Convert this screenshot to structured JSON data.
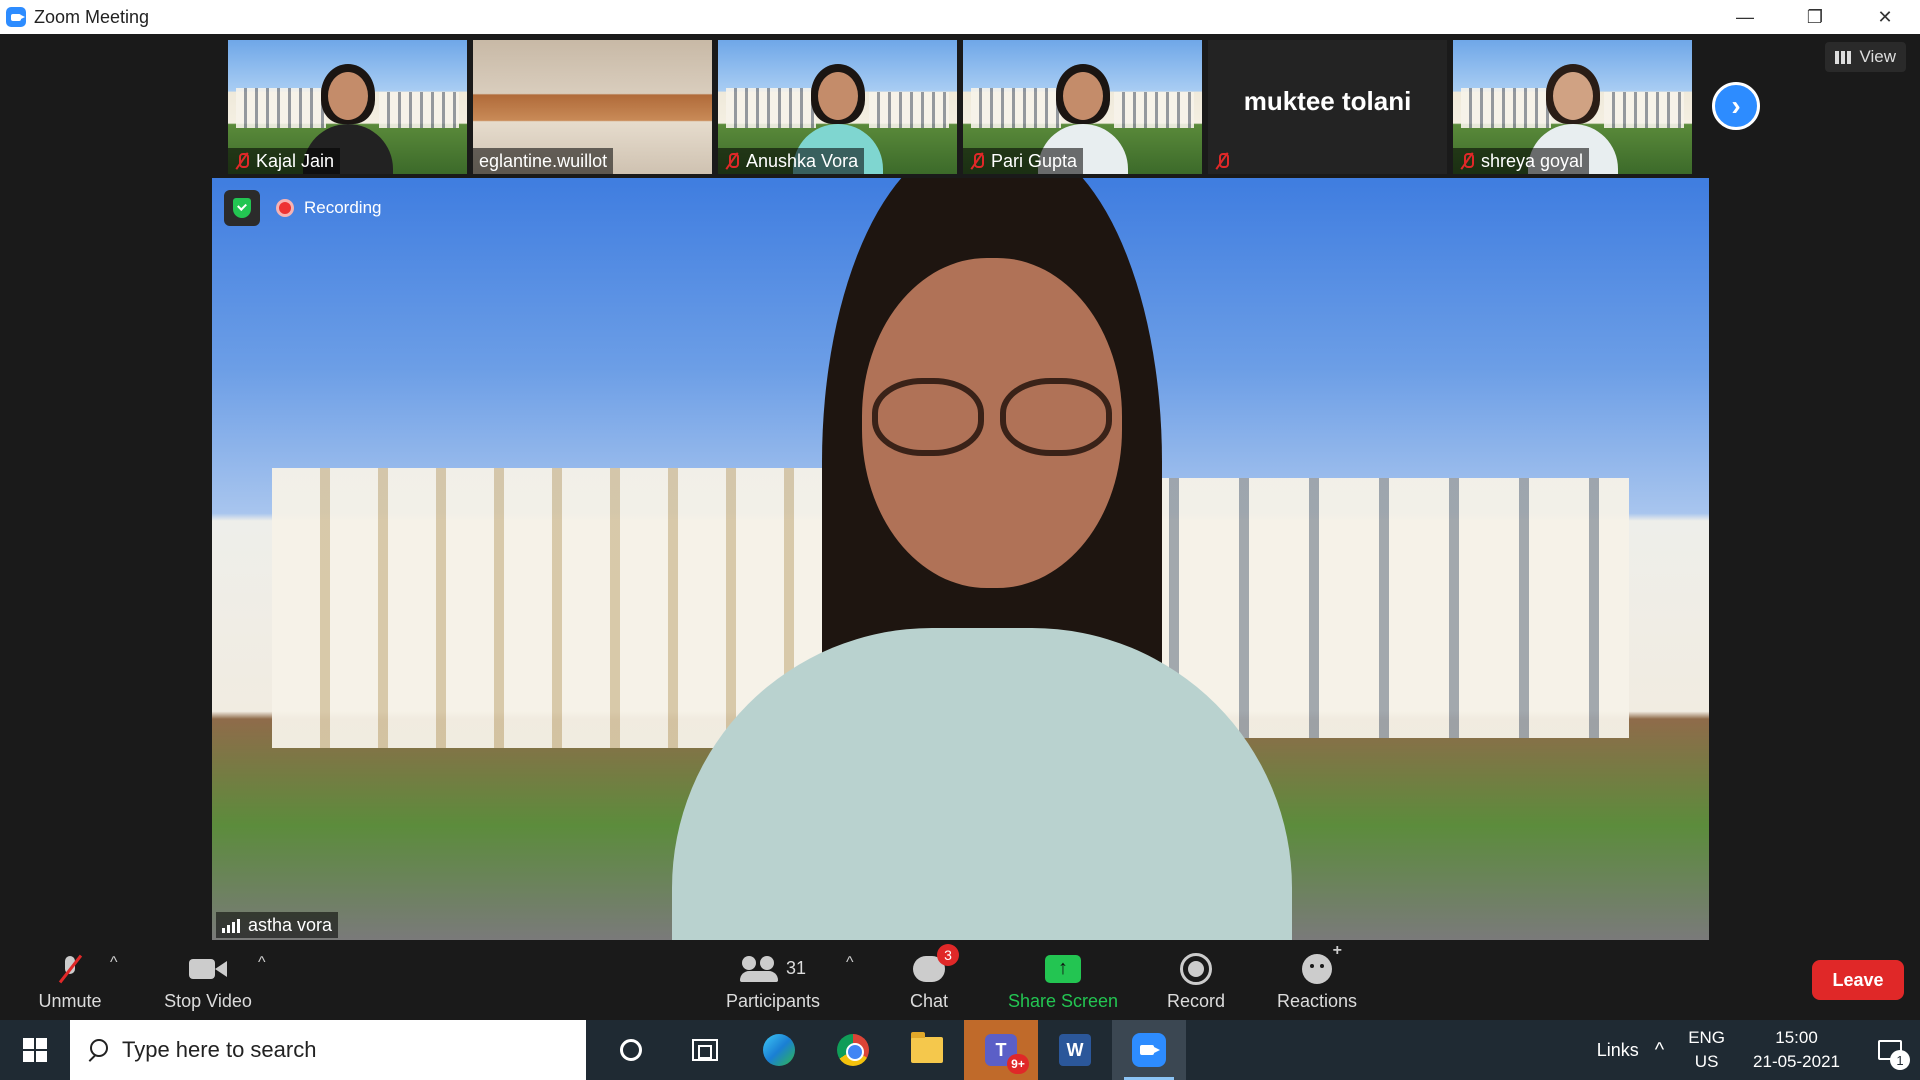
{
  "window": {
    "title": "Zoom Meeting",
    "minimize": "—",
    "restore": "❐",
    "close": "✕"
  },
  "gallery": {
    "tiles": [
      {
        "name": "Kajal Jain",
        "muted": true,
        "background": "campus"
      },
      {
        "name": "eglantine.wuillot",
        "muted": false,
        "background": "classroom"
      },
      {
        "name": "Anushka Vora",
        "muted": true,
        "background": "campus"
      },
      {
        "name": "Pari Gupta",
        "muted": true,
        "background": "campus"
      },
      {
        "name": "muktee tolani",
        "muted": true,
        "background": "none"
      },
      {
        "name": "shreya goyal",
        "muted": true,
        "background": "campus"
      }
    ],
    "next_icon": "›",
    "view_label": "View"
  },
  "main_video": {
    "status": "Recording",
    "speaker_name": "astha vora"
  },
  "toolbar": {
    "unmute_label": "Unmute",
    "stop_video_label": "Stop Video",
    "participants_label": "Participants",
    "participants_count": "31",
    "chat_label": "Chat",
    "chat_badge": "3",
    "share_label": "Share Screen",
    "share_icon": "↑",
    "record_label": "Record",
    "reactions_label": "Reactions",
    "leave_label": "Leave",
    "caret": "^"
  },
  "taskbar": {
    "search_placeholder": "Type here to search",
    "teams_letter": "T",
    "teams_badge": "9+",
    "word_letter": "W",
    "links_label": "Links",
    "tray_chevron": "^",
    "lang_top": "ENG",
    "lang_bottom": "US",
    "time": "15:00",
    "date": "21-05-2021",
    "notification_count": "1"
  },
  "colors": {
    "zoom_blue": "#2d8cff",
    "share_green": "#23c552",
    "leave_red": "#e02828",
    "taskbar": "#1f2a33"
  }
}
